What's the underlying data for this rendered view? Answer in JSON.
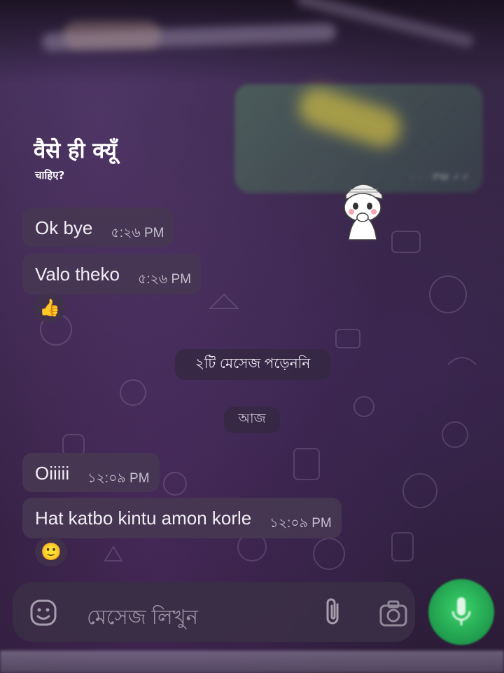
{
  "overlay": {
    "title": "वैसे ही क्यूँ",
    "subtitle": "चाहिए?"
  },
  "messages": [
    {
      "text": "Ok bye",
      "time": "৫:২৬ PM"
    },
    {
      "text": "Valo theko",
      "time": "৫:২৬ PM",
      "reaction": "👍"
    },
    {
      "text": "Oiiiii",
      "time": "১২:০৯ PM"
    },
    {
      "text": "Hat katbo kintu amon korle",
      "time": "১২:০৯ PM",
      "reaction": "🙂"
    }
  ],
  "unread_banner": "২টি মেসেজ পড়েননি",
  "date_chip": "আজ",
  "composer": {
    "placeholder": "মেসেজ লিখুন",
    "emoji_icon": "sticker-emoji-icon",
    "attach_icon": "paperclip-icon",
    "camera_icon": "camera-icon",
    "mic_icon": "microphone-icon"
  },
  "colors": {
    "mic_button": "#22b04f",
    "bubble": "#46374f",
    "background": "#352441"
  }
}
